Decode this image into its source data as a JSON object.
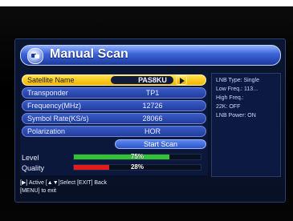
{
  "window": {
    "title": "Manual Scan"
  },
  "form": {
    "rows": [
      {
        "label": "Satellite Name",
        "value": "PAS8KU",
        "selected": true
      },
      {
        "label": "Transponder",
        "value": "TP1",
        "selected": false
      },
      {
        "label": "Frequency(MHz)",
        "value": "12726",
        "selected": false
      },
      {
        "label": "Symbol Rate(KS/s)",
        "value": "28066",
        "selected": false
      },
      {
        "label": "Polarization",
        "value": "HOR",
        "selected": false
      }
    ],
    "start_button": {
      "label": "Start Scan"
    }
  },
  "signal": {
    "level": {
      "label": "Level",
      "percent_text": "75%",
      "value": 0.75,
      "color": "#31c531"
    },
    "quality": {
      "label": "Quality",
      "percent_text": "28%",
      "value": 0.28,
      "color": "#e51c1c"
    }
  },
  "info": {
    "lines": [
      "LNB Type: Single",
      "Low Freq.: 113...",
      "High Freq.:",
      "22K: OFF",
      "LNB Power: ON"
    ]
  },
  "help": {
    "line1": "[▶] Active  [▲▼]Select  [EXIT] Back",
    "line2": "[MENU] to exit"
  }
}
